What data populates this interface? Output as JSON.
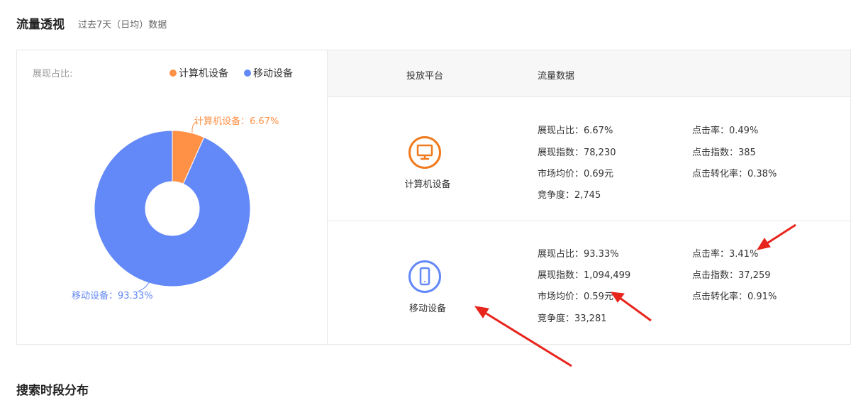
{
  "header": {
    "title": "流量透视",
    "subtitle": "过去7天（日均）数据"
  },
  "left": {
    "label": "展现占比:",
    "legend": [
      {
        "label": "计算机设备",
        "color": "#ff9147"
      },
      {
        "label": "移动设备",
        "color": "#6388f7"
      }
    ]
  },
  "chart_data": {
    "type": "pie",
    "donut": true,
    "slices": [
      {
        "name": "计算机设备",
        "value": 6.67,
        "label": "计算机设备：6.67%",
        "color": "#ff9147"
      },
      {
        "name": "移动设备",
        "value": 93.33,
        "label": "移动设备：93.33%",
        "color": "#6388f7"
      }
    ]
  },
  "table": {
    "headers": [
      "投放平台",
      "流量数据"
    ],
    "rows": [
      {
        "platform": "计算机设备",
        "icon": "monitor-icon",
        "color": "#f07a1e",
        "col1": [
          "展现占比：6.67%",
          "展现指数：78,230",
          "市场均价：0.69元",
          "竞争度：2,745"
        ],
        "col2": [
          "点击率：0.49%",
          "点击指数：385",
          "点击转化率：0.38%"
        ]
      },
      {
        "platform": "移动设备",
        "icon": "phone-icon",
        "color": "#6388f7",
        "col1": [
          "展现占比：93.33%",
          "展现指数：1,094,499",
          "市场均价：0.59元",
          "竞争度：33,281"
        ],
        "col2": [
          "点击率：3.41%",
          "点击指数：37,259",
          "点击转化率：0.91%"
        ]
      }
    ]
  },
  "next_section": {
    "title": "搜索时段分布"
  }
}
